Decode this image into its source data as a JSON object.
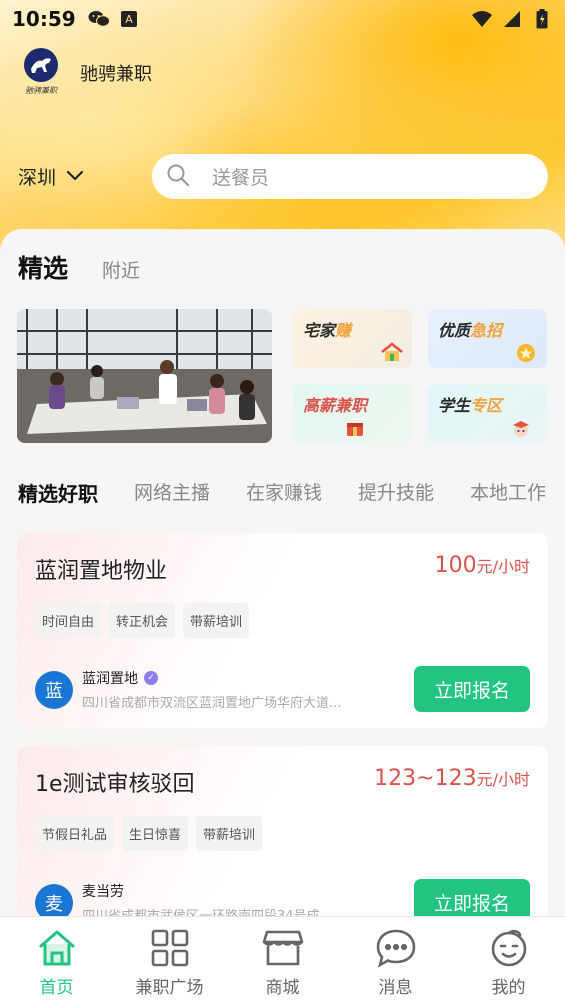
{
  "status_bar": {
    "time": "10:59",
    "left_icons": [
      "wechat-icon",
      "app-a-icon"
    ],
    "right_icons": [
      "wifi-icon",
      "signal-icon",
      "battery-icon"
    ]
  },
  "brand": {
    "name": "驰骋兼职",
    "logo_caption": "驰骋兼职"
  },
  "location": {
    "city": "深圳"
  },
  "search": {
    "placeholder": "送餐员"
  },
  "top_tabs": [
    {
      "label": "精选",
      "active": true
    },
    {
      "label": "附近",
      "active": false
    }
  ],
  "quick_tiles": [
    {
      "label_a": "宅家",
      "label_b": "赚",
      "icon": "house-icon"
    },
    {
      "label_a": "优质",
      "label_b": "急招",
      "icon": "medal-icon"
    },
    {
      "label_a": "高薪兼职",
      "label_b": "",
      "icon": "gift-icon"
    },
    {
      "label_a": "学生",
      "label_b": "专区",
      "icon": "student-icon"
    }
  ],
  "category_tabs": [
    {
      "label": "精选好职",
      "active": true
    },
    {
      "label": "网络主播",
      "active": false
    },
    {
      "label": "在家赚钱",
      "active": false
    },
    {
      "label": "提升技能",
      "active": false
    },
    {
      "label": "本地工作",
      "active": false
    }
  ],
  "jobs": [
    {
      "title": "蓝润置地物业",
      "salary": "100",
      "salary_unit": "元/小时",
      "tags": [
        "时间自由",
        "转正机会",
        "带薪培训"
      ],
      "company_avatar": "蓝",
      "company_name": "蓝润置地",
      "verified": true,
      "address": "四川省成都市双流区蓝润置地广场华府大道...",
      "apply_label": "立即报名"
    },
    {
      "title": "1e测试审核驳回",
      "salary": "123~123",
      "salary_unit": "元/小时",
      "tags": [
        "节假日礼品",
        "生日惊喜",
        "带薪培训"
      ],
      "company_avatar": "麦",
      "company_name": "麦当劳",
      "verified": false,
      "address": "四川省成都市武侯区一环路南四段34号成...",
      "apply_label": "立即报名"
    }
  ],
  "bottom_nav": [
    {
      "label": "首页",
      "icon": "home-icon",
      "active": true
    },
    {
      "label": "兼职广场",
      "icon": "grid-icon",
      "active": false
    },
    {
      "label": "商城",
      "icon": "store-icon",
      "active": false
    },
    {
      "label": "消息",
      "icon": "chat-icon",
      "active": false
    },
    {
      "label": "我的",
      "icon": "profile-icon",
      "active": false
    }
  ],
  "colors": {
    "accent_green": "#22c481",
    "highlight_green": "#3fe07a",
    "salary_red": "#d9534f",
    "avatar_blue": "#1976d2"
  }
}
